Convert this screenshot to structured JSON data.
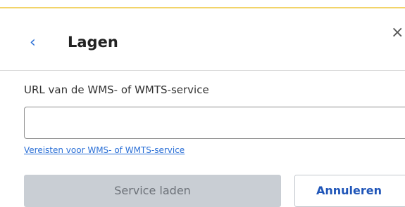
{
  "panel": {
    "title": "Lagen",
    "back_icon": "chevron-left-icon",
    "close_icon": "close-icon",
    "back_glyph": "‹",
    "close_glyph": "×"
  },
  "form": {
    "url_label": "URL van de WMS- of WMTS-service",
    "url_value": "",
    "url_placeholder": "",
    "requirements_link": "Vereisten voor WMS- of WMTS-service"
  },
  "actions": {
    "load_label": "Service laden",
    "load_enabled": false,
    "cancel_label": "Annuleren"
  },
  "colors": {
    "accent": "#2a6fd6",
    "top_border": "#f2d46a",
    "disabled_button": "#c9ced4"
  }
}
